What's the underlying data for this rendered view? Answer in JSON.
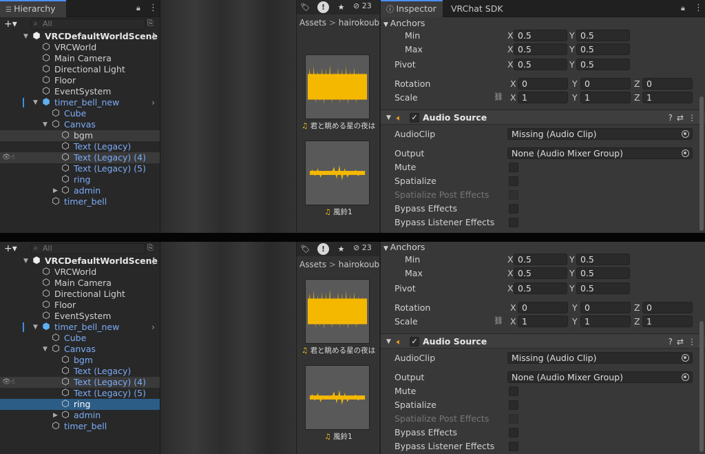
{
  "hierarchy": {
    "tab": "Hierarchy",
    "search_placeholder": "All",
    "scene": "VRCDefaultWorldScene",
    "items": [
      "VRCWorld",
      "Main Camera",
      "Directional Light",
      "Floor",
      "EventSystem",
      "timer_bell_new",
      "Cube",
      "Canvas",
      "bgm",
      "Text (Legacy)",
      "Text (Legacy) (4)",
      "Text (Legacy) (5)",
      "ring",
      "admin",
      "timer_bell"
    ]
  },
  "project": {
    "hidden_count": "23",
    "breadcrumb_root": "Assets",
    "breadcrumb_sep": ">",
    "breadcrumb_folder": "hairokoubo",
    "assets": [
      "君と眺める星の夜は",
      "風鈴1"
    ]
  },
  "inspector": {
    "tabs": [
      "Inspector",
      "VRChat SDK"
    ],
    "anchors": "Anchors",
    "min": "Min",
    "max": "Max",
    "pivot": "Pivot",
    "rotation": "Rotation",
    "scale": "Scale",
    "axis": {
      "x": "X",
      "y": "Y",
      "z": "Z"
    },
    "v05": "0.5",
    "v0": "0",
    "v1": "1",
    "component": "Audio Source",
    "audio_clip_label": "AudioClip",
    "audio_clip_value": "Missing (Audio Clip)",
    "output_label": "Output",
    "output_value": "None (Audio Mixer Group)",
    "mute": "Mute",
    "spatialize": "Spatialize",
    "spatialize_post": "Spatialize Post Effects",
    "bypass": "Bypass Effects",
    "bypass_listener": "Bypass Listener Effects"
  },
  "colors": {
    "accent": "#4a8ff6",
    "selection": "#2c5d87",
    "waveform": "#f5b800",
    "prefab": "#5fb0f0"
  }
}
